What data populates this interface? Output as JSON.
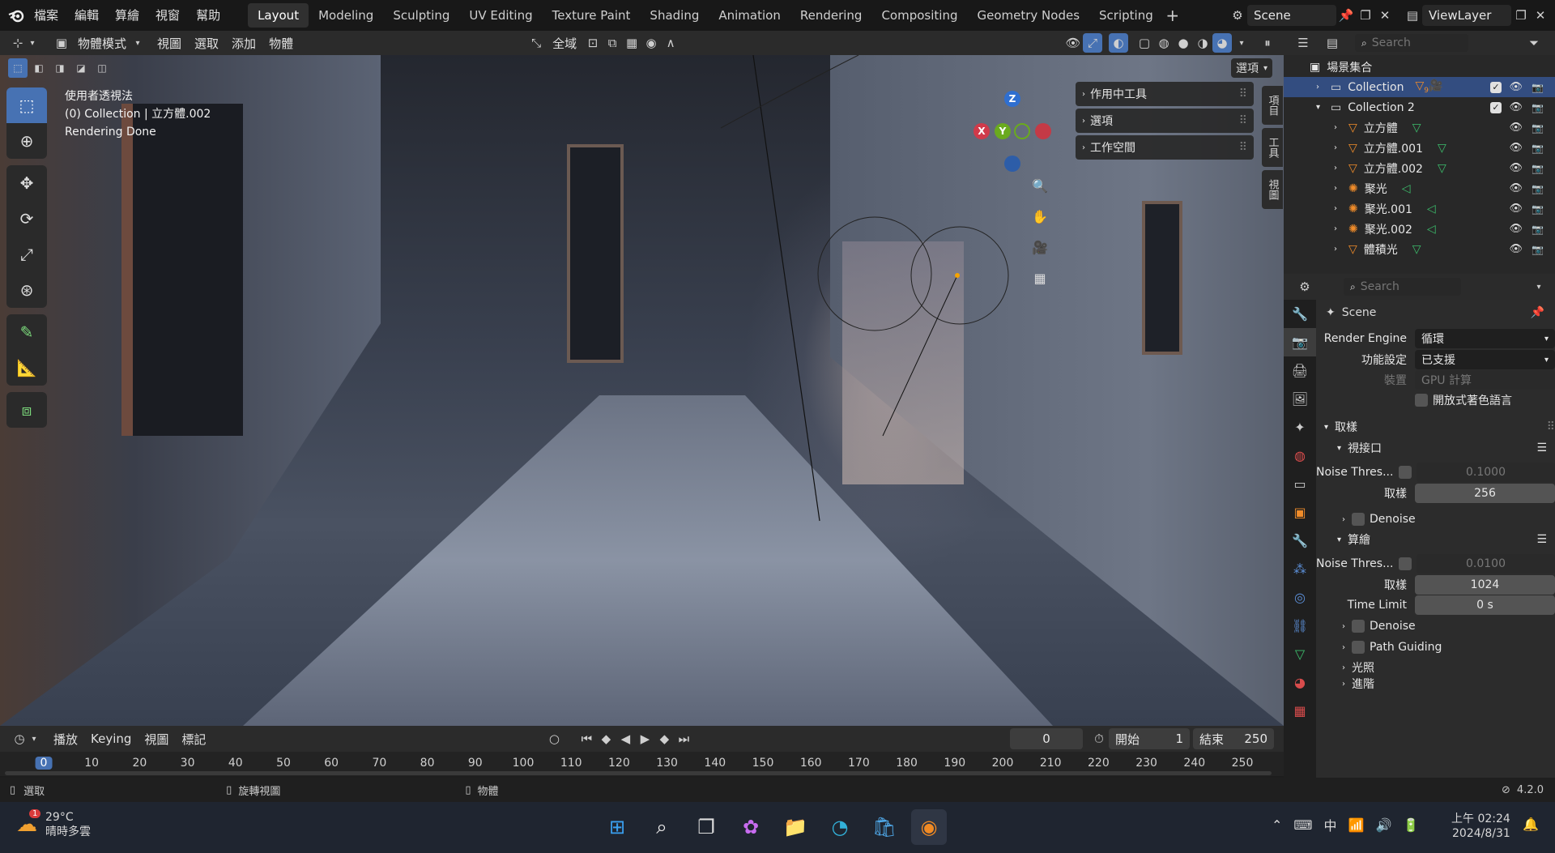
{
  "menu": {
    "items": [
      "檔案",
      "編輯",
      "算繪",
      "視窗",
      "幫助"
    ],
    "workspaces": [
      "Layout",
      "Modeling",
      "Sculpting",
      "UV Editing",
      "Texture Paint",
      "Shading",
      "Animation",
      "Rendering",
      "Compositing",
      "Geometry Nodes",
      "Scripting"
    ],
    "active_workspace": "Layout",
    "scene": "Scene",
    "view_layer": "ViewLayer"
  },
  "viewport_header": {
    "mode": "物體模式",
    "menus": [
      "視圖",
      "選取",
      "添加",
      "物體"
    ],
    "orientation": "全域",
    "options": "選項"
  },
  "viewport": {
    "view_name": "使用者透視法",
    "collection_line": "(0) Collection | 立方體.002",
    "status": "Rendering Done",
    "axes": {
      "z": "Z",
      "x": "X",
      "y": "Y"
    }
  },
  "npanel": {
    "items": [
      "作用中工具",
      "選項",
      "工作空間"
    ],
    "tabs": [
      "項目",
      "工具",
      "視圖"
    ]
  },
  "timeline": {
    "menus": [
      "播放",
      "Keying",
      "視圖",
      "標記"
    ],
    "current_frame": "0",
    "start_label": "開始",
    "start": "1",
    "end_label": "結束",
    "end": "250",
    "ticks": [
      "0",
      "10",
      "20",
      "30",
      "40",
      "50",
      "60",
      "70",
      "80",
      "90",
      "100",
      "110",
      "120",
      "130",
      "140",
      "150",
      "160",
      "170",
      "180",
      "190",
      "200",
      "210",
      "220",
      "230",
      "240",
      "250"
    ]
  },
  "status_bar": {
    "select": "選取",
    "rotate": "旋轉視圖",
    "object": "物體",
    "version": "4.2.0"
  },
  "outliner": {
    "search_placeholder": "Search",
    "root": "場景集合",
    "rows": [
      {
        "name": "Collection",
        "selected": true
      },
      {
        "name": "Collection 2",
        "selected": false
      },
      {
        "name": "立方體",
        "selected": false
      },
      {
        "name": "立方體.001",
        "selected": false
      },
      {
        "name": "立方體.002",
        "selected": false
      },
      {
        "name": "聚光",
        "selected": false
      },
      {
        "name": "聚光.001",
        "selected": false
      },
      {
        "name": "聚光.002",
        "selected": false
      },
      {
        "name": "體積光",
        "selected": false
      }
    ],
    "collection_badge": "9"
  },
  "properties": {
    "search_placeholder": "Search",
    "scene_name": "Scene",
    "render_engine_label": "Render Engine",
    "render_engine": "循環",
    "feature_set_label": "功能設定",
    "feature_set": "已支援",
    "device_label": "裝置",
    "device": "GPU 計算",
    "osl_label": "開放式著色語言",
    "sampling_label": "取樣",
    "viewport_label": "視接口",
    "noise_thresh_label": "Noise Thres...",
    "viewport_noise": "0.1000",
    "samples_label": "取樣",
    "viewport_samples": "256",
    "denoise_label": "Denoise",
    "render_label": "算繪",
    "render_noise": "0.0100",
    "render_samples": "1024",
    "time_limit_label": "Time Limit",
    "time_limit": "0 s",
    "path_guiding_label": "Path Guiding",
    "light_paths_label": "光照",
    "advanced_label": "進階"
  },
  "taskbar": {
    "weather_temp": "29°C",
    "weather_desc": "晴時多雲",
    "weather_badge": "1",
    "ime": "中",
    "time": "上午 02:24",
    "date": "2024/8/31"
  }
}
